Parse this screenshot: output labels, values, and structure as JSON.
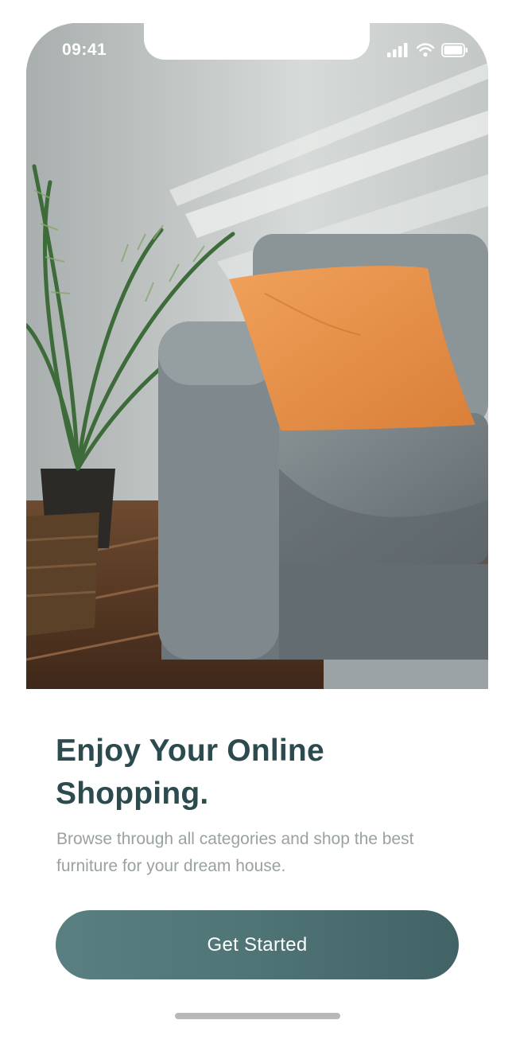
{
  "status_bar": {
    "time": "09:41"
  },
  "icons": {
    "signal": "cellular-signal-icon",
    "wifi": "wifi-icon",
    "battery": "battery-icon"
  },
  "hero": {
    "image": "living-room-sofa-photo"
  },
  "onboarding": {
    "title": "Enjoy Your Online Shopping.",
    "subtitle": "Browse through all categories and shop the best furniture for your dream house.",
    "cta_label": "Get Started"
  },
  "colors": {
    "accent": "#4f7476",
    "title": "#2c4b4f",
    "subtitle": "#9aa1a3",
    "cushion": "#e8914b",
    "sofa": "#7b8488"
  }
}
